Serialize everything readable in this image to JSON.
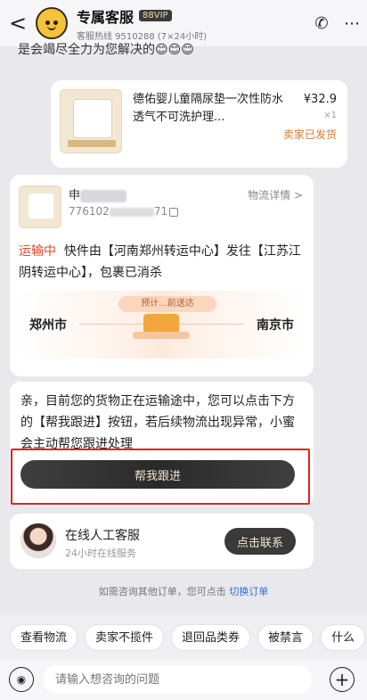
{
  "header": {
    "back_glyph": "<",
    "title": "专属客服",
    "vip_badge": "88VIP",
    "subtitle": "客服热线 9510288 (7×24小时)",
    "phone_glyph": "✆",
    "more_glyph": "⋯"
  },
  "chat": {
    "truncated_message": "是会竭尽全力为您解决的😊😊😊"
  },
  "product": {
    "name": "德佑婴儿童隔尿垫一次性防水透气不可洗护理...",
    "price": "¥32.9",
    "quantity": "×1",
    "status": "卖家已发货"
  },
  "logistics": {
    "receiver_prefix": "申",
    "tracking_suffix": "71",
    "tracking_prefix": "776102",
    "detail_link": "物流详情 >",
    "status_label": "运输中",
    "description": "快件由【河南郑州转运中心】发往【江苏江阴转运中心】，包裹已消杀",
    "route_tag": "预计...前送达",
    "from_city": "郑州市",
    "to_city": "南京市"
  },
  "help": {
    "text": "亲，目前您的货物正在运输途中，您可以点击下方的【帮我跟进】按钮，若后续物流出现异常，小蜜会主动帮您跟进处理",
    "button_label": "帮我跟进"
  },
  "service": {
    "name": "在线人工客服",
    "sub": "24小时在线服务",
    "contact_label": "点击联系"
  },
  "switch_tip": {
    "text": "如需咨询其他订单，您可点击",
    "link": "切换订单"
  },
  "quick_chips": [
    "查看物流",
    "卖家不揽件",
    "退回品类券",
    "被禁言",
    "什么"
  ],
  "input": {
    "placeholder": "请输入想咨询的问题",
    "voice_glyph": "◉",
    "plus_glyph": "+"
  },
  "colors": {
    "accent_red": "#e2462b",
    "status_orange": "#e07a2a",
    "link_blue": "#2f6fd6",
    "highlight_red": "#e0241c"
  }
}
